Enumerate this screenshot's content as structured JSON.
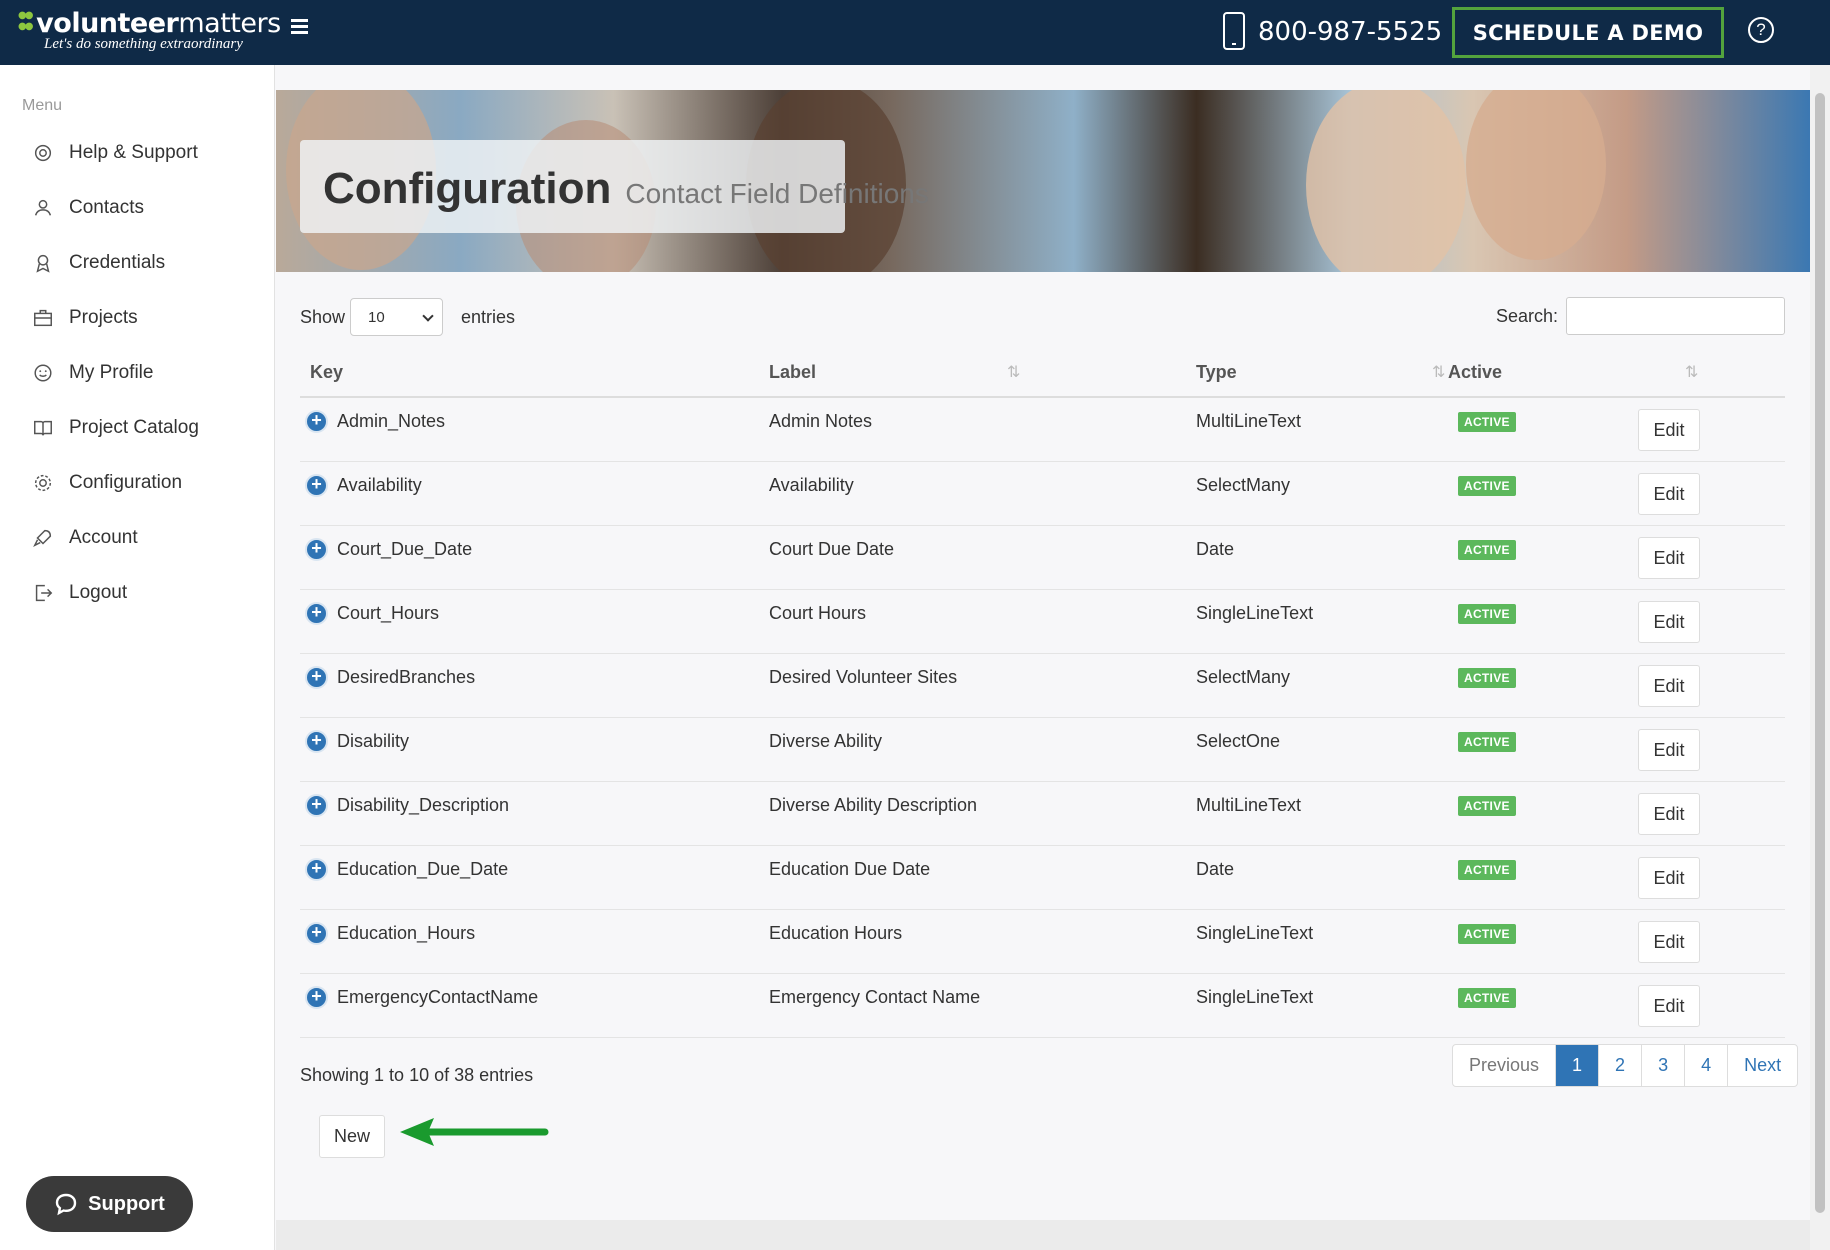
{
  "header": {
    "logo_main_bold": "volunteer",
    "logo_main_light": "matters",
    "logo_tagline": "Let's do something extraordinary",
    "phone": "800-987-5525",
    "demo_button": "SCHEDULE A DEMO",
    "help_symbol": "?"
  },
  "sidebar": {
    "menu_label": "Menu",
    "items": [
      {
        "label": "Help & Support",
        "icon": "lifebuoy-icon"
      },
      {
        "label": "Contacts",
        "icon": "user-icon"
      },
      {
        "label": "Credentials",
        "icon": "badge-icon"
      },
      {
        "label": "Projects",
        "icon": "briefcase-icon"
      },
      {
        "label": "My Profile",
        "icon": "smiley-icon"
      },
      {
        "label": "Project Catalog",
        "icon": "book-icon"
      },
      {
        "label": "Configuration",
        "icon": "gear-icon"
      },
      {
        "label": "Account",
        "icon": "rocket-icon"
      },
      {
        "label": "Logout",
        "icon": "logout-icon"
      }
    ],
    "support_button": "Support"
  },
  "page": {
    "title": "Configuration",
    "subtitle": "Contact Field Definitions"
  },
  "controls": {
    "show_label": "Show",
    "page_size": "10",
    "entries_label": "entries",
    "search_label": "Search:",
    "search_value": ""
  },
  "table": {
    "columns": [
      "Key",
      "Label",
      "Type",
      "Active"
    ],
    "rows": [
      {
        "key": "Admin_Notes",
        "label": "Admin Notes",
        "type": "MultiLineText",
        "status": "ACTIVE",
        "action": "Edit"
      },
      {
        "key": "Availability",
        "label": "Availability",
        "type": "SelectMany",
        "status": "ACTIVE",
        "action": "Edit"
      },
      {
        "key": "Court_Due_Date",
        "label": "Court Due Date",
        "type": "Date",
        "status": "ACTIVE",
        "action": "Edit"
      },
      {
        "key": "Court_Hours",
        "label": "Court Hours",
        "type": "SingleLineText",
        "status": "ACTIVE",
        "action": "Edit"
      },
      {
        "key": "DesiredBranches",
        "label": "Desired Volunteer Sites",
        "type": "SelectMany",
        "status": "ACTIVE",
        "action": "Edit"
      },
      {
        "key": "Disability",
        "label": "Diverse Ability",
        "type": "SelectOne",
        "status": "ACTIVE",
        "action": "Edit"
      },
      {
        "key": "Disability_Description",
        "label": "Diverse Ability Description",
        "type": "MultiLineText",
        "status": "ACTIVE",
        "action": "Edit"
      },
      {
        "key": "Education_Due_Date",
        "label": "Education Due Date",
        "type": "Date",
        "status": "ACTIVE",
        "action": "Edit"
      },
      {
        "key": "Education_Hours",
        "label": "Education Hours",
        "type": "SingleLineText",
        "status": "ACTIVE",
        "action": "Edit"
      },
      {
        "key": "EmergencyContactName",
        "label": "Emergency Contact Name",
        "type": "SingleLineText",
        "status": "ACTIVE",
        "action": "Edit"
      }
    ],
    "expand_symbol": "+"
  },
  "footer": {
    "info": "Showing 1 to 10 of 38 entries",
    "pagination": [
      "Previous",
      "1",
      "2",
      "3",
      "4",
      "Next"
    ],
    "current_page": "1",
    "new_button": "New"
  },
  "colors": {
    "header_bg": "#0f2a47",
    "accent_green": "#53a33d",
    "badge_green": "#5cb85c",
    "link_blue": "#2f74b5",
    "arrow_green": "#1a9a2e"
  }
}
